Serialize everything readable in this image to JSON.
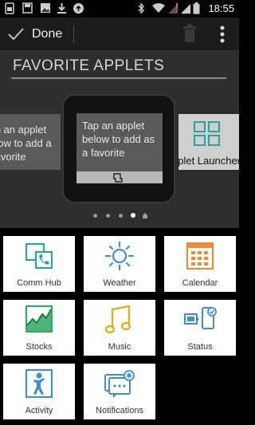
{
  "status_bar": {
    "time": "18:55",
    "icons": [
      "sim-icon",
      "save-icon",
      "image-icon",
      "download-icon",
      "sync-icon",
      "bluetooth-icon",
      "wifi-icon",
      "no-signal-icon",
      "signal-icon",
      "battery-icon"
    ]
  },
  "action_bar": {
    "done_label": "Done",
    "trash_icon": "trash-icon",
    "overflow_icon": "overflow-menu-icon"
  },
  "favorites": {
    "title": "FAVORITE APPLETS",
    "left_card_text": "Tap an applet below to add a favorite",
    "left_card_lines": [
      "Tap an applet",
      "below to add a",
      "favorite"
    ],
    "center_card_text": "Tap an applet below to add as a favorite",
    "right_card_label": "Applet Launcher",
    "right_card_visible_label": "pplet Launcher"
  },
  "pager": {
    "count": 5,
    "active_index": 3
  },
  "applets": [
    {
      "label": "Comm Hub",
      "icon": "comm-hub-icon",
      "color": "#2aa3a0"
    },
    {
      "label": "Weather",
      "icon": "weather-icon",
      "color": "#3f8fd0"
    },
    {
      "label": "Calendar",
      "icon": "calendar-icon",
      "color": "#f08a36"
    },
    {
      "label": "Stocks",
      "icon": "stocks-icon",
      "color": "#33a860"
    },
    {
      "label": "Music",
      "icon": "music-icon",
      "color": "#e0b020"
    },
    {
      "label": "Status",
      "icon": "status-icon",
      "color": "#3f8fd0"
    },
    {
      "label": "Activity",
      "icon": "activity-icon",
      "color": "#3f8fd0"
    },
    {
      "label": "Notifications",
      "icon": "notifications-icon",
      "color": "#3f8fd0"
    }
  ],
  "colors": {
    "panel": "#2e2e2e",
    "card": "#5a5a5a",
    "accent_teal": "#2aa3a0",
    "accent_blue": "#3f8fd0",
    "accent_orange": "#f08a36"
  }
}
